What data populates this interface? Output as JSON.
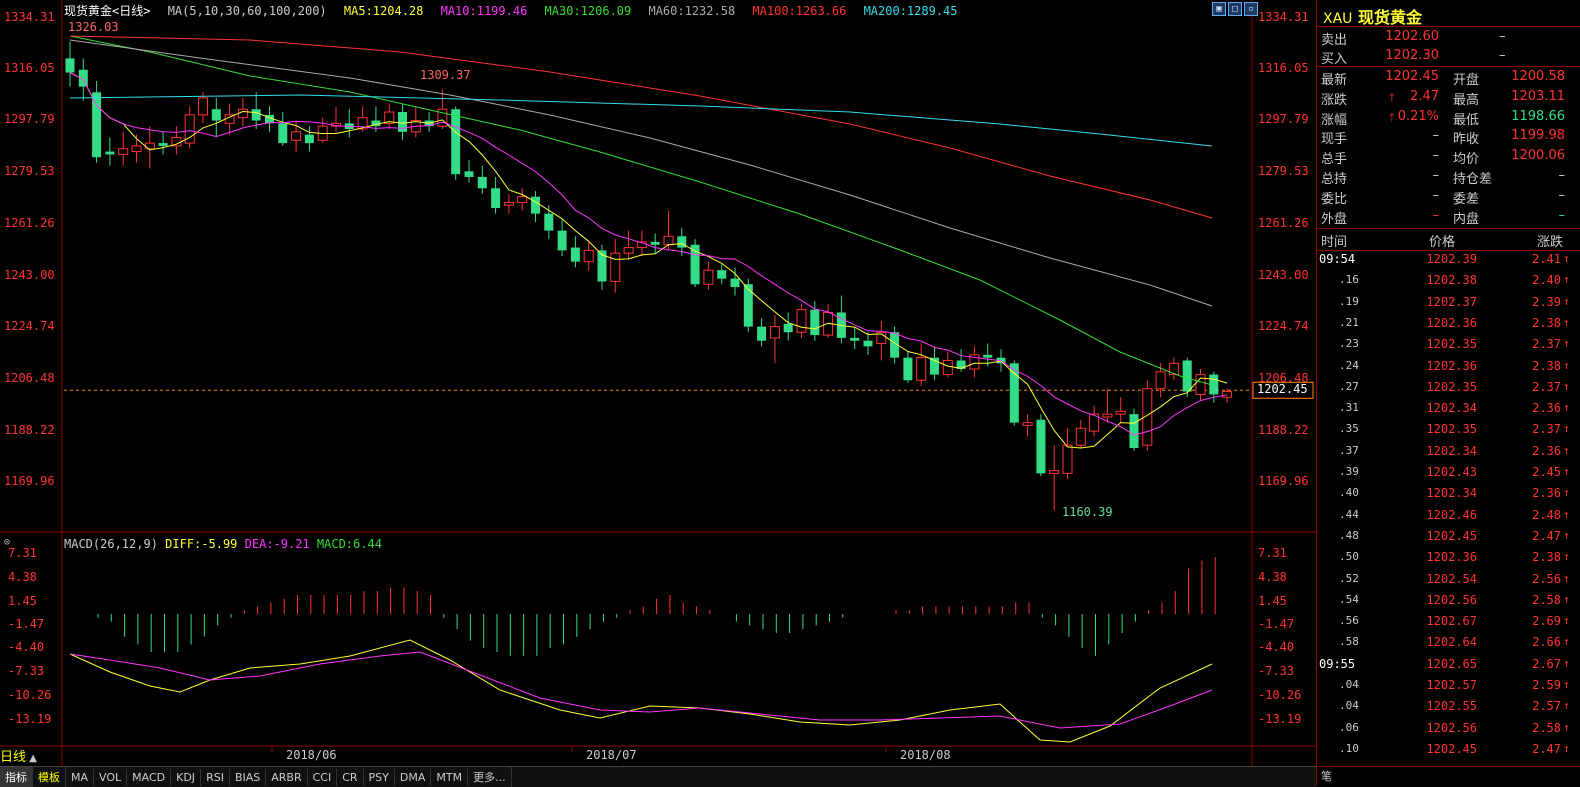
{
  "info": {
    "symbol": "现货黄金",
    "period": "<日线>",
    "ma_formula": "MA(5,10,30,60,100,200)",
    "ma5": "MA5:1204.28",
    "ma10": "MA10:1199.46",
    "ma30": "MA30:1206.09",
    "ma60": "MA60:1232.58",
    "ma100": "MA100:1263.66",
    "ma200": "MA200:1289.45"
  },
  "colors": {
    "ma5": "#ffff33",
    "ma10": "#ff33ff",
    "ma30": "#33dd33",
    "ma60": "#aaaaaa",
    "ma100": "#ff3333",
    "ma200": "#33ddee",
    "up": "#ff3333",
    "down": "#33dd88"
  },
  "price_axis": [
    "1334.31",
    "1316.05",
    "1297.79",
    "1279.53",
    "1261.26",
    "1243.00",
    "1224.74",
    "1206.48",
    "1188.22",
    "1169.96"
  ],
  "current_price_tag": "1202.45",
  "annotations": {
    "high1": "1326.03",
    "high2": "1309.37",
    "low": "1160.39"
  },
  "macd": {
    "formula": "MACD(26,12,9)",
    "diff": "DIFF:-5.99",
    "dea": "DEA:-9.21",
    "macd": "MACD:6.44",
    "axis": [
      "7.31",
      "4.38",
      "1.45",
      "-1.47",
      "-4.40",
      "-7.33",
      "-10.26",
      "-13.19"
    ]
  },
  "x_axis": [
    "2018/06",
    "2018/07",
    "2018/08"
  ],
  "period_tab": "日线",
  "bottom_tabs": [
    "指标",
    "模板",
    "MA",
    "VOL",
    "MACD",
    "KDJ",
    "RSI",
    "BIAS",
    "ARBR",
    "CCI",
    "CR",
    "PSY",
    "DMA",
    "MTM",
    "更多..."
  ],
  "quote": {
    "code": "XAU",
    "name": "现货黄金",
    "sell_label": "卖出",
    "sell": "1202.60",
    "sell_vol": "–",
    "buy_label": "买入",
    "buy": "1202.30",
    "buy_vol": "–",
    "rows": [
      {
        "l1": "最新",
        "v1": "1202.45",
        "l2": "开盘",
        "v2": "1200.58"
      },
      {
        "l1": "涨跌",
        "v1": "2.47",
        "l2": "最高",
        "v2": "1203.11"
      },
      {
        "l1": "涨幅",
        "v1": "0.21%",
        "l2": "最低",
        "v2": "1198.66"
      },
      {
        "l1": "现手",
        "v1": "–",
        "l2": "昨收",
        "v2": "1199.98"
      },
      {
        "l1": "总手",
        "v1": "–",
        "l2": "均价",
        "v2": "1200.06"
      },
      {
        "l1": "总持",
        "v1": "–",
        "l2": "持仓差",
        "v2": "–"
      },
      {
        "l1": "委比",
        "v1": "–",
        "l2": "委差",
        "v2": "–"
      },
      {
        "l1": "外盘",
        "v1": "–",
        "l2": "内盘",
        "v2": "–"
      }
    ],
    "tick_headers": [
      "时间",
      "价格",
      "涨跌"
    ],
    "ticks": [
      {
        "t": "09:54",
        "p": "1202.39",
        "c": "2.41"
      },
      {
        "t": ".16",
        "p": "1202.38",
        "c": "2.40"
      },
      {
        "t": ".19",
        "p": "1202.37",
        "c": "2.39"
      },
      {
        "t": ".21",
        "p": "1202.36",
        "c": "2.38"
      },
      {
        "t": ".23",
        "p": "1202.35",
        "c": "2.37"
      },
      {
        "t": ".24",
        "p": "1202.36",
        "c": "2.38"
      },
      {
        "t": ".27",
        "p": "1202.35",
        "c": "2.37"
      },
      {
        "t": ".31",
        "p": "1202.34",
        "c": "2.36"
      },
      {
        "t": ".35",
        "p": "1202.35",
        "c": "2.37"
      },
      {
        "t": ".37",
        "p": "1202.34",
        "c": "2.36"
      },
      {
        "t": ".39",
        "p": "1202.43",
        "c": "2.45"
      },
      {
        "t": ".40",
        "p": "1202.34",
        "c": "2.36"
      },
      {
        "t": ".44",
        "p": "1202.46",
        "c": "2.48"
      },
      {
        "t": ".48",
        "p": "1202.45",
        "c": "2.47"
      },
      {
        "t": ".50",
        "p": "1202.36",
        "c": "2.38"
      },
      {
        "t": ".52",
        "p": "1202.54",
        "c": "2.56"
      },
      {
        "t": ".54",
        "p": "1202.56",
        "c": "2.58"
      },
      {
        "t": ".56",
        "p": "1202.67",
        "c": "2.69"
      },
      {
        "t": ".58",
        "p": "1202.64",
        "c": "2.66"
      },
      {
        "t": "09:55",
        "p": "1202.65",
        "c": "2.67"
      },
      {
        "t": ".04",
        "p": "1202.57",
        "c": "2.59"
      },
      {
        "t": ".04",
        "p": "1202.55",
        "c": "2.57"
      },
      {
        "t": ".06",
        "p": "1202.56",
        "c": "2.58"
      },
      {
        "t": ".10",
        "p": "1202.45",
        "c": "2.47"
      }
    ],
    "footer": "笔"
  }
}
